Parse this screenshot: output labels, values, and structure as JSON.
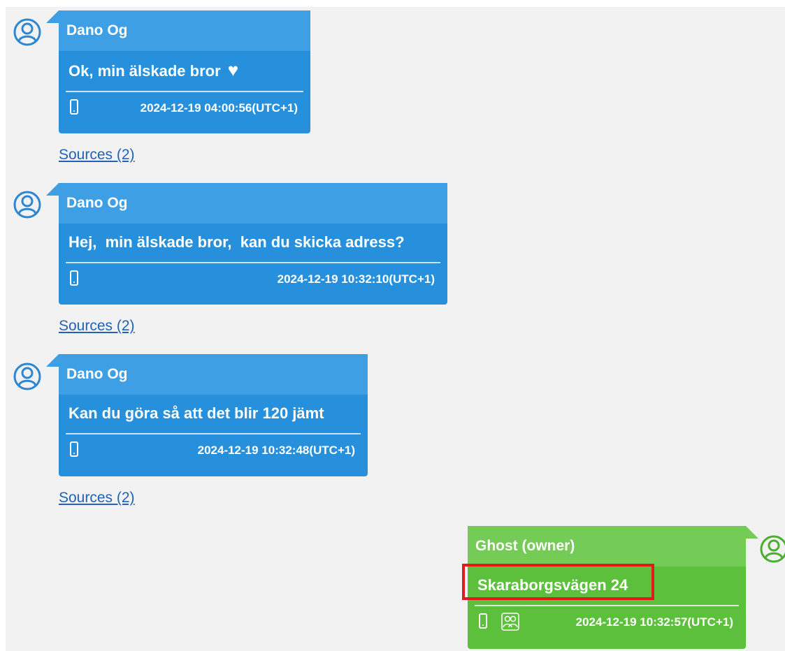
{
  "messages": [
    {
      "sender": "Dano Og",
      "text": "Ok, min älskade bror",
      "heart": "♥",
      "timestamp": "2024-12-19 04:00:56(UTC+1)",
      "sources": "Sources (2)"
    },
    {
      "sender": "Dano Og",
      "text": "Hej,  min älskade bror,  kan du skicka adress?",
      "timestamp": "2024-12-19 10:32:10(UTC+1)",
      "sources": "Sources (2)"
    },
    {
      "sender": "Dano Og",
      "text": "Kan du göra så att det blir 120 jämt",
      "timestamp": "2024-12-19 10:32:48(UTC+1)",
      "sources": "Sources (2)"
    },
    {
      "sender": "Ghost (owner)",
      "text": "Skaraborgsvägen 24",
      "timestamp": "2024-12-19 10:32:57(UTC+1)"
    }
  ],
  "icons": {
    "avatar": "user-avatar-icon",
    "device": "phone-icon",
    "group": "group-icon",
    "heart": "heart-icon"
  },
  "colors": {
    "incoming_bubble": "#2790dc",
    "incoming_header": "#3f9fe5",
    "outgoing_bubble": "#5dc03c",
    "outgoing_header": "#74cb55",
    "highlight_box": "#e31a1a",
    "link": "#1f62b8"
  }
}
